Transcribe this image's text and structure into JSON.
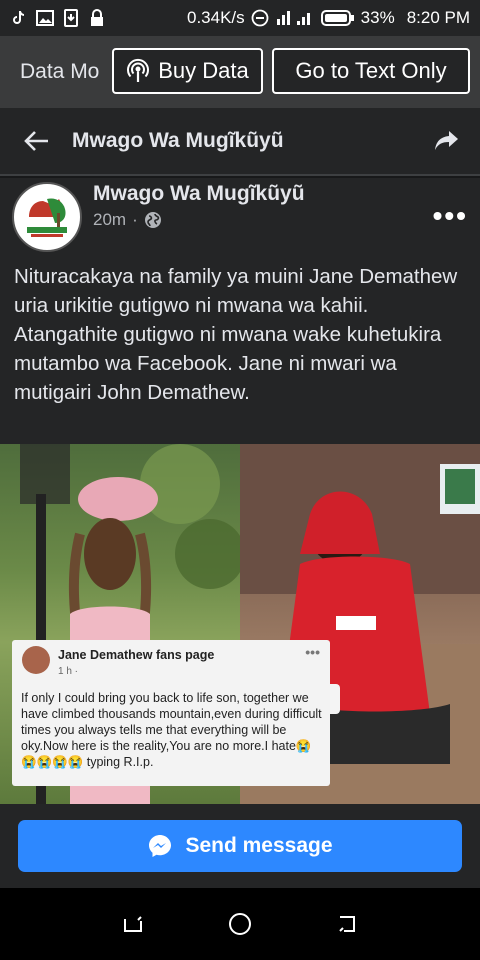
{
  "status_bar": {
    "speed": "0.34K/s",
    "battery": "33%",
    "time": "8:20 PM",
    "icons": [
      "tiktok-icon",
      "image-icon",
      "download-icon",
      "lock-icon",
      "dnd-icon",
      "signal-icon",
      "battery-icon"
    ]
  },
  "data_bar": {
    "mode_label": "Data Mo",
    "buy_label": "Buy Data",
    "text_only_label": "Go to Text Only"
  },
  "nav": {
    "title": "Mwago Wa Mugĩkũyũ"
  },
  "post": {
    "author": "Mwago Wa Mugĩkũyũ",
    "time": "20m",
    "separator": "·",
    "text": "Nituracakaya na family ya muini Jane Demathew uria urikitie gutigwo ni mwana wa kahii. Atangathite gutigwo ni mwana wake kuhetukira mutambo wa Facebook. Jane ni mwari wa mutigairi John Demathew."
  },
  "embedded_card": {
    "name": "Jane Demathew fans page",
    "meta": "1 h ·",
    "text": "If only I could bring you back to life son, together we have climbed thousands  mountain,even during  difficult  times you always tells me that everything will be oky.Now here is the reality,You are no more.I hate😭😭😭😭😭 typing R.I.p."
  },
  "cta": {
    "send_label": "Send message"
  },
  "colors": {
    "accent": "#2d88ff",
    "bg": "#242526"
  }
}
